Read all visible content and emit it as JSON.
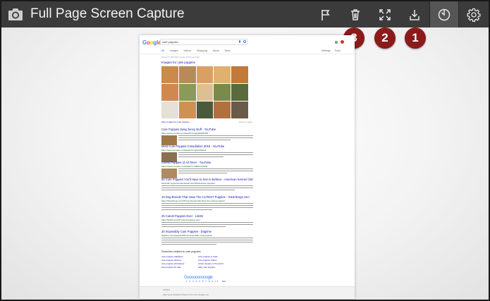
{
  "app": {
    "title": "Full Page Screen Capture"
  },
  "toolbar": {
    "buttons": [
      {
        "name": "flag-button",
        "icon": "flag-icon"
      },
      {
        "name": "delete-button",
        "icon": "trash-icon"
      },
      {
        "name": "fullscreen-button",
        "icon": "expand-icon"
      },
      {
        "name": "download-button",
        "icon": "download-icon"
      },
      {
        "name": "history-button",
        "icon": "timer-icon"
      },
      {
        "name": "settings-button",
        "icon": "gear-icon"
      }
    ]
  },
  "callouts": [
    "3",
    "2",
    "1"
  ],
  "colors": {
    "toolbar_bg": "#3b3b3b",
    "callout_bg": "#8b1a1a",
    "link_blue": "#1a0dab",
    "url_green": "#006621"
  },
  "capture": {
    "logo": "Google",
    "query": "cute puppies",
    "tabs": [
      "All",
      "Images",
      "Videos",
      "Shopping",
      "News",
      "More"
    ],
    "tabs_right": [
      "Settings",
      "Tools"
    ],
    "result_stats": "About 57,400,000 results (0.52 seconds)",
    "images_heading": "Images for cute puppies",
    "more_images": "More images for cute puppies",
    "report_images": "Report images",
    "results": [
      {
        "title": "Cute Puppies doing funny stuff - YouTube",
        "url": "https://www.youtube.com/watch?v=qgxSfuFBnhM",
        "thumb": true
      },
      {
        "title": "Most Cute Puppies Compilation 2015 - YouTube",
        "url": "https://www.youtube.com/watch?v=cjUVrK8tcv4",
        "thumb": true
      },
      {
        "title": "Cutest Puppies of All Time! - YouTube",
        "url": "https://www.youtube.com/watch?v=oB6iiYcFNG8",
        "thumb": true
      },
      {
        "title": "50 Cute Puppies You'll Have to See to Believe - American Kennel Club",
        "url": "www.akc.org/content/entertainment/articles/cute-puppies/",
        "thumb": false
      },
      {
        "title": "15 Dog Breeds That Have The CUTEST Puppies - IHeartDogs.com",
        "url": "https://iheartdogs.com/15-dog-breeds-that-have-the-cutest-puppies/",
        "thumb": false
      },
      {
        "title": "25 Cutest Puppies Ever - List25",
        "url": "https://list25.com/25-cutest-puppies-ever/",
        "thumb": false
      },
      {
        "title": "30 Impossibly Cute Puppies - Dogtime",
        "url": "dogtime.com/puppies/255-30-impossibly-cute-puppies",
        "thumb": false
      }
    ],
    "related_heading": "Searches related to cute puppies",
    "related": [
      "cute puppies wallpaper",
      "cute puppies to draw",
      "cute puppies pictures",
      "cute puppies videos",
      "cute puppies and kittens",
      "cutest puppies in the world",
      "cute puppies for sale",
      "baby cute puppies"
    ],
    "pager_logo": "Goooooooooogle",
    "pager_pages": "1 2 3 4 5 6 7 8 9 10",
    "pager_next": "Next",
    "footer_line1": "Canada",
    "footer_line2": "Help   Send feedback   Privacy   Terms   Use Google.com"
  }
}
